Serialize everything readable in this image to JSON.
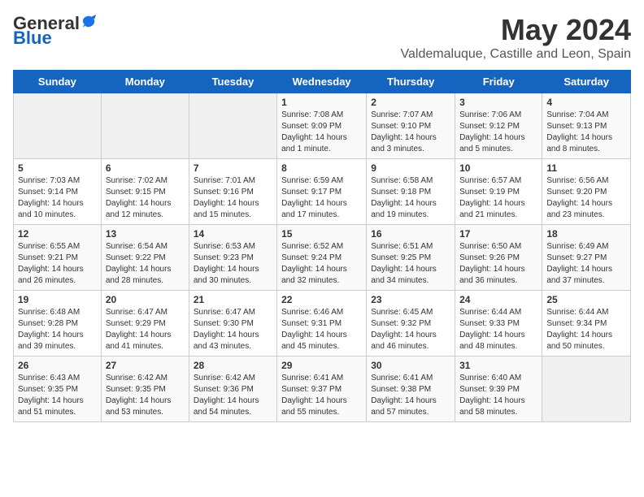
{
  "logo": {
    "general": "General",
    "blue": "Blue"
  },
  "title": {
    "month_year": "May 2024",
    "location": "Valdemaluque, Castille and Leon, Spain"
  },
  "weekdays": [
    "Sunday",
    "Monday",
    "Tuesday",
    "Wednesday",
    "Thursday",
    "Friday",
    "Saturday"
  ],
  "weeks": [
    [
      {
        "day": "",
        "content": ""
      },
      {
        "day": "",
        "content": ""
      },
      {
        "day": "",
        "content": ""
      },
      {
        "day": "1",
        "content": "Sunrise: 7:08 AM\nSunset: 9:09 PM\nDaylight: 14 hours\nand 1 minute."
      },
      {
        "day": "2",
        "content": "Sunrise: 7:07 AM\nSunset: 9:10 PM\nDaylight: 14 hours\nand 3 minutes."
      },
      {
        "day": "3",
        "content": "Sunrise: 7:06 AM\nSunset: 9:12 PM\nDaylight: 14 hours\nand 5 minutes."
      },
      {
        "day": "4",
        "content": "Sunrise: 7:04 AM\nSunset: 9:13 PM\nDaylight: 14 hours\nand 8 minutes."
      }
    ],
    [
      {
        "day": "5",
        "content": "Sunrise: 7:03 AM\nSunset: 9:14 PM\nDaylight: 14 hours\nand 10 minutes."
      },
      {
        "day": "6",
        "content": "Sunrise: 7:02 AM\nSunset: 9:15 PM\nDaylight: 14 hours\nand 12 minutes."
      },
      {
        "day": "7",
        "content": "Sunrise: 7:01 AM\nSunset: 9:16 PM\nDaylight: 14 hours\nand 15 minutes."
      },
      {
        "day": "8",
        "content": "Sunrise: 6:59 AM\nSunset: 9:17 PM\nDaylight: 14 hours\nand 17 minutes."
      },
      {
        "day": "9",
        "content": "Sunrise: 6:58 AM\nSunset: 9:18 PM\nDaylight: 14 hours\nand 19 minutes."
      },
      {
        "day": "10",
        "content": "Sunrise: 6:57 AM\nSunset: 9:19 PM\nDaylight: 14 hours\nand 21 minutes."
      },
      {
        "day": "11",
        "content": "Sunrise: 6:56 AM\nSunset: 9:20 PM\nDaylight: 14 hours\nand 23 minutes."
      }
    ],
    [
      {
        "day": "12",
        "content": "Sunrise: 6:55 AM\nSunset: 9:21 PM\nDaylight: 14 hours\nand 26 minutes."
      },
      {
        "day": "13",
        "content": "Sunrise: 6:54 AM\nSunset: 9:22 PM\nDaylight: 14 hours\nand 28 minutes."
      },
      {
        "day": "14",
        "content": "Sunrise: 6:53 AM\nSunset: 9:23 PM\nDaylight: 14 hours\nand 30 minutes."
      },
      {
        "day": "15",
        "content": "Sunrise: 6:52 AM\nSunset: 9:24 PM\nDaylight: 14 hours\nand 32 minutes."
      },
      {
        "day": "16",
        "content": "Sunrise: 6:51 AM\nSunset: 9:25 PM\nDaylight: 14 hours\nand 34 minutes."
      },
      {
        "day": "17",
        "content": "Sunrise: 6:50 AM\nSunset: 9:26 PM\nDaylight: 14 hours\nand 36 minutes."
      },
      {
        "day": "18",
        "content": "Sunrise: 6:49 AM\nSunset: 9:27 PM\nDaylight: 14 hours\nand 37 minutes."
      }
    ],
    [
      {
        "day": "19",
        "content": "Sunrise: 6:48 AM\nSunset: 9:28 PM\nDaylight: 14 hours\nand 39 minutes."
      },
      {
        "day": "20",
        "content": "Sunrise: 6:47 AM\nSunset: 9:29 PM\nDaylight: 14 hours\nand 41 minutes."
      },
      {
        "day": "21",
        "content": "Sunrise: 6:47 AM\nSunset: 9:30 PM\nDaylight: 14 hours\nand 43 minutes."
      },
      {
        "day": "22",
        "content": "Sunrise: 6:46 AM\nSunset: 9:31 PM\nDaylight: 14 hours\nand 45 minutes."
      },
      {
        "day": "23",
        "content": "Sunrise: 6:45 AM\nSunset: 9:32 PM\nDaylight: 14 hours\nand 46 minutes."
      },
      {
        "day": "24",
        "content": "Sunrise: 6:44 AM\nSunset: 9:33 PM\nDaylight: 14 hours\nand 48 minutes."
      },
      {
        "day": "25",
        "content": "Sunrise: 6:44 AM\nSunset: 9:34 PM\nDaylight: 14 hours\nand 50 minutes."
      }
    ],
    [
      {
        "day": "26",
        "content": "Sunrise: 6:43 AM\nSunset: 9:35 PM\nDaylight: 14 hours\nand 51 minutes."
      },
      {
        "day": "27",
        "content": "Sunrise: 6:42 AM\nSunset: 9:35 PM\nDaylight: 14 hours\nand 53 minutes."
      },
      {
        "day": "28",
        "content": "Sunrise: 6:42 AM\nSunset: 9:36 PM\nDaylight: 14 hours\nand 54 minutes."
      },
      {
        "day": "29",
        "content": "Sunrise: 6:41 AM\nSunset: 9:37 PM\nDaylight: 14 hours\nand 55 minutes."
      },
      {
        "day": "30",
        "content": "Sunrise: 6:41 AM\nSunset: 9:38 PM\nDaylight: 14 hours\nand 57 minutes."
      },
      {
        "day": "31",
        "content": "Sunrise: 6:40 AM\nSunset: 9:39 PM\nDaylight: 14 hours\nand 58 minutes."
      },
      {
        "day": "",
        "content": ""
      }
    ]
  ]
}
